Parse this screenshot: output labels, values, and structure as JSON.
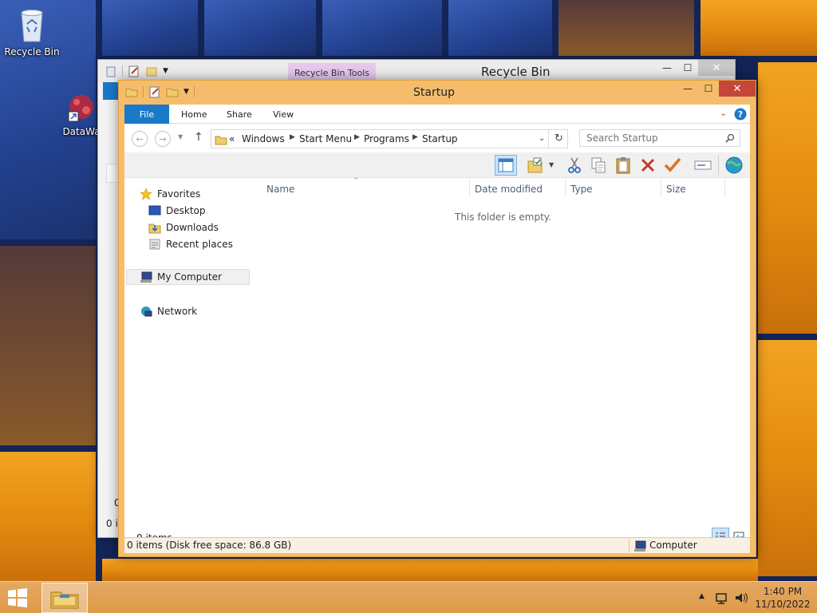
{
  "desktop": {
    "icons": [
      {
        "label": "Recycle Bin"
      },
      {
        "label": "DataWa"
      }
    ]
  },
  "back_window": {
    "title": "Recycle Bin",
    "tools_tab": "Recycle Bin Tools",
    "partial_texts": [
      "0",
      "0 it"
    ]
  },
  "window": {
    "title": "Startup",
    "caption": {
      "minimize": "—",
      "maximize": "☐",
      "close": "✕"
    },
    "ribbon_tabs": [
      "File",
      "Home",
      "Share",
      "View"
    ],
    "address": {
      "overflow": "«",
      "breadcrumbs": [
        "Windows",
        "Start Menu",
        "Programs",
        "Startup"
      ]
    },
    "search": {
      "placeholder": "Search Startup"
    },
    "nav_pane": {
      "favorites": "Favorites",
      "favorites_items": [
        "Desktop",
        "Downloads",
        "Recent places"
      ],
      "computer": "My Computer",
      "network": "Network"
    },
    "columns": [
      "Name",
      "Date modified",
      "Type",
      "Size"
    ],
    "empty_message": "This folder is empty.",
    "item_count": "0 items",
    "status": {
      "left": "0 items (Disk free space: 86.8 GB)",
      "right": "Computer"
    }
  },
  "taskbar": {
    "time": "1:40 PM",
    "date": "11/10/2022"
  }
}
